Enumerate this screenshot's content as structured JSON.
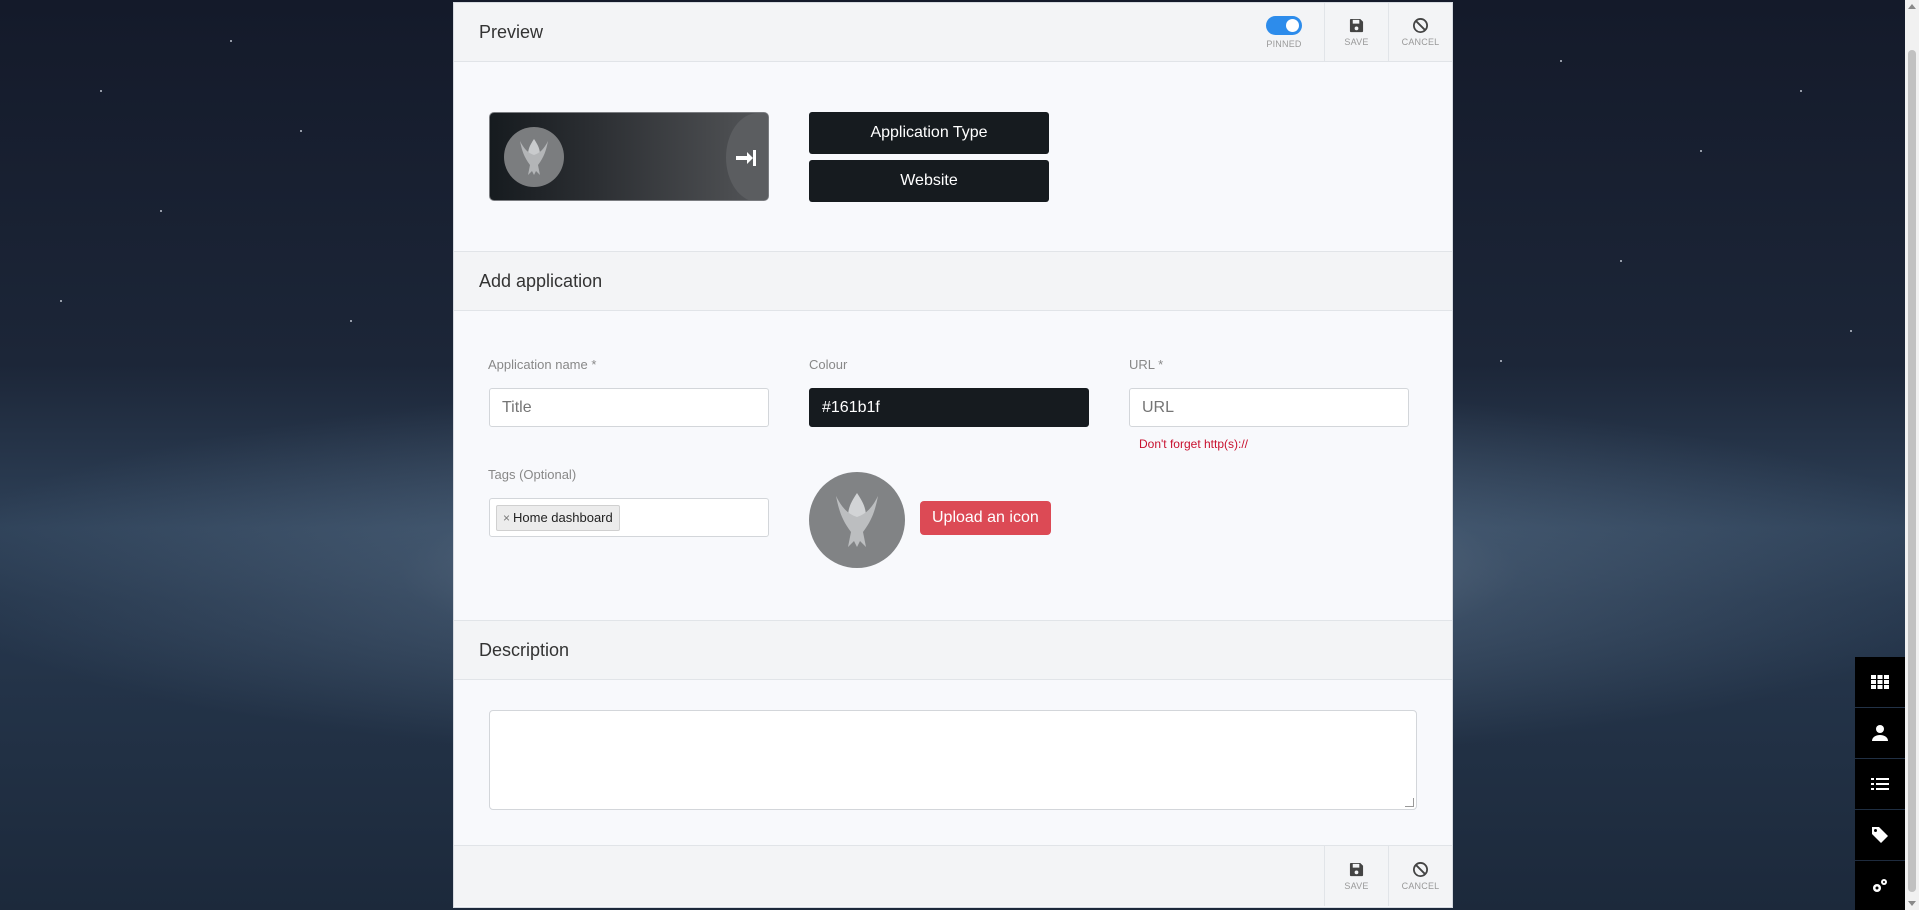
{
  "preview": {
    "title": "Preview",
    "pinned_label": "PINNED",
    "save_label": "SAVE",
    "cancel_label": "CANCEL",
    "tag_buttons": [
      "Application Type",
      "Website"
    ]
  },
  "add_application": {
    "title": "Add application",
    "name_label": "Application name *",
    "name_placeholder": "Title",
    "colour_label": "Colour",
    "colour_value": "#161b1f",
    "url_label": "URL *",
    "url_placeholder": "URL",
    "url_hint": "Don't forget http(s)://",
    "tags_label": "Tags (Optional)",
    "tags": [
      "Home dashboard"
    ],
    "tag_remove": "×",
    "upload_label": "Upload an icon"
  },
  "description": {
    "title": "Description"
  },
  "footer": {
    "save_label": "SAVE",
    "cancel_label": "CANCEL"
  },
  "sidebar_tools": [
    "grid-icon",
    "user-icon",
    "list-icon",
    "tag-icon",
    "cogs-icon"
  ],
  "colors": {
    "accent": "#2d8ceb",
    "app_colour": "#161b1f",
    "upload_button": "#dc4a55",
    "error_text": "#c8102e"
  }
}
